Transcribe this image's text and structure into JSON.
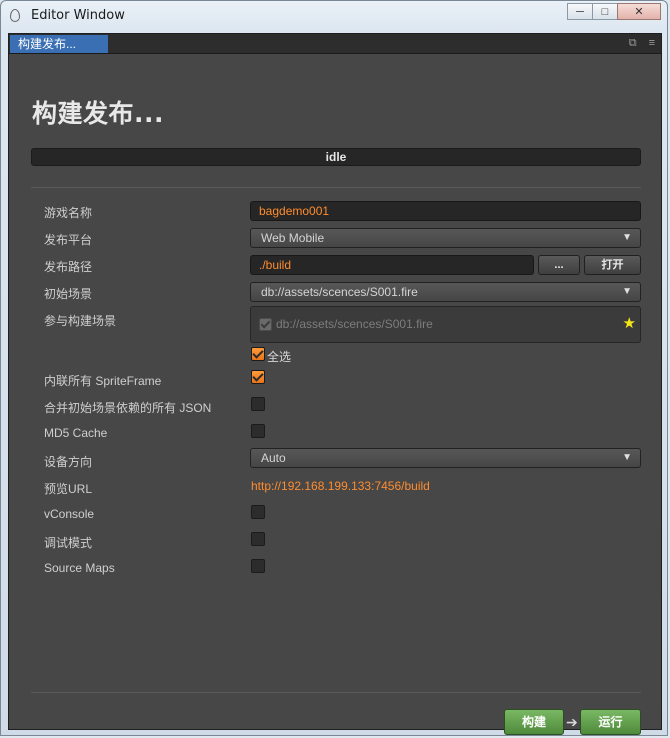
{
  "window": {
    "title": "Editor Window",
    "minimize": "─",
    "maximize": "□",
    "close": "✕"
  },
  "tab": {
    "label": "构建发布...",
    "restore_icon": "⧉",
    "menu_icon": "≡"
  },
  "heading": "构建发布...",
  "status": "idle",
  "form": {
    "game_name": {
      "label": "游戏名称",
      "value": "bagdemo001"
    },
    "platform": {
      "label": "发布平台",
      "value": "Web Mobile"
    },
    "build_path": {
      "label": "发布路径",
      "value": "./build",
      "browse_label": "...",
      "open_label": "打开"
    },
    "start_scene": {
      "label": "初始场景",
      "value": "db://assets/scences/S001.fire"
    },
    "build_scenes": {
      "label": "参与构建场景",
      "items": [
        {
          "path": "db://assets/scences/S001.fire",
          "checked": true,
          "disabled": true
        }
      ],
      "select_all_label": "全选",
      "select_all_checked": true
    },
    "inline_sprite": {
      "label": "内联所有 SpriteFrame",
      "checked": true
    },
    "merge_json": {
      "label": "合并初始场景依赖的所有 JSON",
      "checked": false
    },
    "md5_cache": {
      "label": "MD5 Cache",
      "checked": false
    },
    "orientation": {
      "label": "设备方向",
      "value": "Auto"
    },
    "preview_url": {
      "label": "预览URL",
      "value": "http://192.168.199.133:7456/build"
    },
    "vconsole": {
      "label": "vConsole",
      "checked": false
    },
    "debug": {
      "label": "调试模式",
      "checked": false
    },
    "source_maps": {
      "label": "Source Maps",
      "checked": false
    }
  },
  "actions": {
    "build_label": "构建",
    "run_label": "运行"
  },
  "colors": {
    "accent": "#ff8c2e",
    "tab_active": "#3a6fb3",
    "build_button": "#5f9c4b",
    "panel_bg": "#474747"
  }
}
